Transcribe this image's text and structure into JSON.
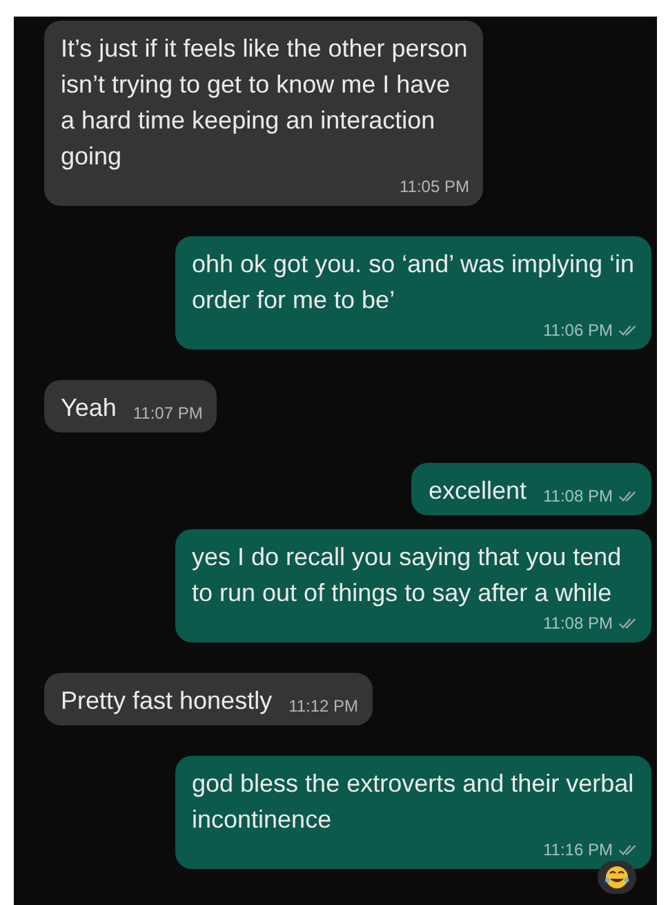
{
  "messages": [
    {
      "outgoing": false,
      "text": "It’s just if it feels like the other person isn’t trying to get to know me I have a hard time keeping an interaction going",
      "time": "11:05 PM"
    },
    {
      "outgoing": true,
      "text": "ohh ok got you. so ‘and’ was implying ‘in order for me to be’",
      "time": "11:06 PM",
      "read": false
    },
    {
      "outgoing": false,
      "text": "Yeah",
      "time": "11:07 PM"
    },
    {
      "outgoing": true,
      "text": "excellent",
      "time": "11:08 PM",
      "read": false
    },
    {
      "outgoing": true,
      "text": "yes I do recall you saying that you tend to run out of things to say after a while",
      "time": "11:08 PM",
      "read": false
    },
    {
      "outgoing": false,
      "text": "Pretty fast honestly",
      "time": "11:12 PM"
    },
    {
      "outgoing": true,
      "text": "god bless the extroverts and their verbal incontinence",
      "time": "11:16 PM",
      "read": false,
      "reaction": true
    }
  ]
}
